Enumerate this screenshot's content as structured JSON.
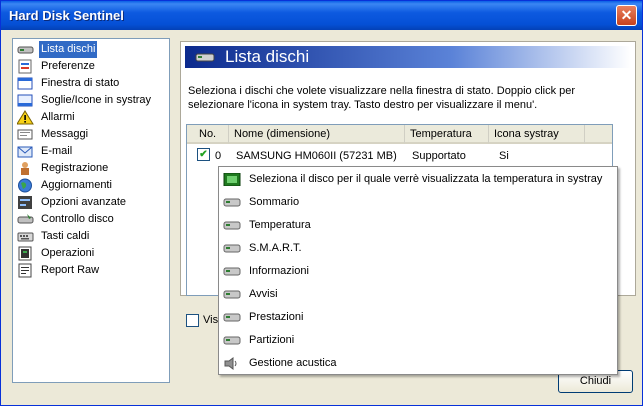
{
  "window": {
    "title": "Hard Disk Sentinel",
    "close_glyph": "✕"
  },
  "tree": {
    "items": [
      {
        "label": "Lista dischi",
        "icon": "disk-icon",
        "selected": true
      },
      {
        "label": "Preferenze",
        "icon": "preferences-icon"
      },
      {
        "label": "Finestra di stato",
        "icon": "window-icon"
      },
      {
        "label": "Soglie/Icone in systray",
        "icon": "threshold-icon"
      },
      {
        "label": "Allarmi",
        "icon": "warning-icon"
      },
      {
        "label": "Messaggi",
        "icon": "message-icon"
      },
      {
        "label": "E-mail",
        "icon": "email-icon"
      },
      {
        "label": "Registrazione",
        "icon": "registration-icon"
      },
      {
        "label": "Aggiornamenti",
        "icon": "globe-icon"
      },
      {
        "label": "Opzioni avanzate",
        "icon": "advanced-options-icon"
      },
      {
        "label": "Controllo disco",
        "icon": "disk-control-icon"
      },
      {
        "label": "Tasti caldi",
        "icon": "keyboard-icon"
      },
      {
        "label": "Operazioni",
        "icon": "operations-icon"
      },
      {
        "label": "Report Raw",
        "icon": "report-icon"
      }
    ]
  },
  "panel": {
    "title": "Lista dischi",
    "description": "Seleziona i dischi che volete visualizzare nella finestra di stato. Doppio click per selezionare l'icona in system tray. Tasto destro per visualizzare il menu'."
  },
  "table": {
    "columns": [
      "No.",
      "Nome (dimensione)",
      "Temperatura",
      "Icona systray"
    ],
    "rows": [
      {
        "checked": true,
        "no": "0",
        "name": "SAMSUNG HM060II (57231 MB)",
        "temperature": "Supportato",
        "systray": "Si"
      }
    ]
  },
  "context_menu": {
    "items": [
      {
        "label": "Seleziona il disco per il quale verrè visualizzata la temperatura in systray",
        "icon": "green-chip-icon"
      },
      {
        "label": "Sommario",
        "icon": "disk-icon"
      },
      {
        "label": "Temperatura",
        "icon": "disk-icon"
      },
      {
        "label": "S.M.A.R.T.",
        "icon": "disk-icon"
      },
      {
        "label": "Informazioni",
        "icon": "disk-icon"
      },
      {
        "label": "Avvisi",
        "icon": "disk-icon"
      },
      {
        "label": "Prestazioni",
        "icon": "disk-icon"
      },
      {
        "label": "Partizioni",
        "icon": "disk-icon"
      },
      {
        "label": "Gestione acustica",
        "icon": "speaker-icon"
      }
    ]
  },
  "bottom_checkbox": {
    "label": "Visu"
  },
  "buttons": {
    "close": "Chiudi"
  }
}
